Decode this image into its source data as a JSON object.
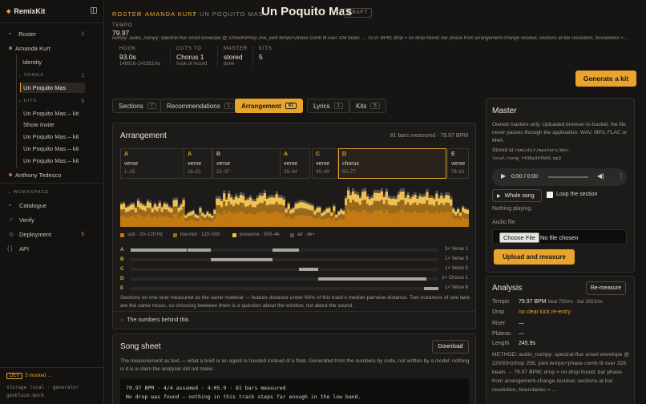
{
  "app": {
    "name": "RemixKit"
  },
  "sidebar": {
    "roster_label": "Roster",
    "roster_count": "2",
    "artist": "Amanda Kurt",
    "identity": "Identity",
    "songs_header": "SONGS",
    "songs_count": "1",
    "song_item": "Un Poquito Mas",
    "kits_header": "KITS",
    "kits_count": "5",
    "kits": [
      "Un Poquito Mas – kit",
      "Show Invite",
      "Un Poquito Mas – kit",
      "Un Poquito Mas – kit",
      "Un Poquito Mas – kit"
    ],
    "other_artist": "Anthony Tedesco",
    "workspace_header": "WORKSPACE",
    "workspace": [
      {
        "label": "Catalogue",
        "count": ""
      },
      {
        "label": "Verify",
        "count": ""
      },
      {
        "label": "Deployment",
        "count": "5"
      },
      {
        "label": "API",
        "count": ""
      }
    ],
    "footer": {
      "env": "DEV",
      "mocked": "5 mocked →",
      "storage": "storage local · generator",
      "genblaze": "genblaze:mock"
    }
  },
  "header": {
    "crumb_roster": "ROSTER",
    "crumb_artist": "AMANDA KURT",
    "crumb_song": "UN POQUITO MAS",
    "title": "Un Poquito Mas",
    "status": "DRAFT",
    "tempo_label": "TEMPO",
    "tempo_value": "79.97",
    "method_note": "numpy: audio_numpy: spectral-flux onset envelope @ 22050Hz/hop 256, joint tempo+phase comb fit over 328 beats → 79.97 BPM; drop = no drop found; bar phase from arrangement-change residue; sections at bar resolution, boundaries = ...",
    "stats": [
      {
        "label": "HOOK",
        "value": "93.0s",
        "sub": "148816–241851ms"
      },
      {
        "label": "CUTS TO",
        "value": "Chorus 1",
        "sub": "hook of record"
      },
      {
        "label": "MASTER",
        "value": "stored",
        "sub": "done"
      },
      {
        "label": "KITS",
        "value": "5",
        "sub": ""
      }
    ],
    "generate_label": "Generate a kit"
  },
  "tabs": [
    {
      "label": "Sections",
      "count": "7"
    },
    {
      "label": "Recommendations",
      "count": "1"
    },
    {
      "label": "Arrangement",
      "count": "81"
    },
    {
      "label": "Lyrics",
      "count": "1"
    },
    {
      "label": "Kits",
      "count": "5"
    }
  ],
  "arrangement": {
    "title": "Arrangement",
    "meta": "81 bars measured · 79.97 BPM",
    "sections": [
      {
        "letter": "A",
        "name": "verse",
        "range": "1–15"
      },
      {
        "letter": "A",
        "name": "verse",
        "range": "16–21"
      },
      {
        "letter": "B",
        "name": "verse",
        "range": "22–37"
      },
      {
        "letter": "A",
        "name": "verse",
        "range": "38–44"
      },
      {
        "letter": "C",
        "name": "verse",
        "range": "45–49"
      },
      {
        "letter": "D",
        "name": "chorus",
        "range": "50–77"
      },
      {
        "letter": "E",
        "name": "verse",
        "range": "78–81"
      }
    ],
    "legend": [
      "sub · 20–120 Hz",
      "low-mid · 120–500",
      "presence · 500–4k",
      "air · 4k+"
    ],
    "legend_colors": [
      "#c47a12",
      "#9a6a1c",
      "#f1c152",
      "#57524b"
    ],
    "lanes": [
      {
        "letter": "A",
        "right": "3× Verse 1"
      },
      {
        "letter": "B",
        "right": "1× Verse 3"
      },
      {
        "letter": "C",
        "right": "1× Verse 5"
      },
      {
        "letter": "D",
        "right": "1× Chorus 1"
      },
      {
        "letter": "E",
        "right": "1× Verse 6"
      }
    ],
    "caption": "Sections on one lane measured as the same material — feature distance under 60% of this track's median pairwise distance. Two instances of one lane are the same music, so choosing between them is a question about the window, not about the sound.",
    "numbers_link": "The numbers behind this"
  },
  "song_sheet": {
    "title": "Song sheet",
    "download": "Download",
    "desc": "The measurement as text — what a brief or an agent is handed instead of a float. Generated from the numbers by code, not written by a model: nothing in it is a claim the analyser did not make.",
    "line1": "79.97 BPM · 4/4 assumed · 4:05.9 · 81 bars measured",
    "line2": "No drop was found — nothing in this track steps far enough in the low band."
  },
  "master": {
    "title": "Master",
    "desc": "Owned masters only. Uploaded browser-to-bucket; the file never passes through the application. WAV, MP3, FLAC or M4A.",
    "stored_prefix": "Stored at ",
    "stored_path": "remixkit/masters/dev-local/song_f438a34fbb9.mp3",
    "time": "0:00 / 0:00",
    "whole_song": "Whole song",
    "loop": "Loop the section",
    "status": "Nothing playing.",
    "audio_label": "Audio file",
    "choose": "Choose File",
    "nofile": "No file chosen",
    "upload": "Upload and measure"
  },
  "analysis": {
    "title": "Analysis",
    "remeasure": "Re-measure",
    "rows": [
      {
        "k": "Tempo",
        "v": "79.97 BPM",
        "extra": "beat 750ms · bar 3001ms"
      },
      {
        "k": "Drop",
        "v": "no clear kick re-entry",
        "extra": ""
      },
      {
        "k": "Riser",
        "v": "—",
        "extra": ""
      },
      {
        "k": "Plateau",
        "v": "—",
        "extra": ""
      },
      {
        "k": "Length",
        "v": "245.9s",
        "extra": ""
      }
    ],
    "method": "METHOD: audio_numpy: spectral-flux onset envelope @ 22050Hz/hop 256, joint tempo+phase comb fit over 328 beats → 79.97 BPM; drop = no drop found; bar phase from arrangement-change residue; sections at bar resolution, boundaries = ..."
  }
}
